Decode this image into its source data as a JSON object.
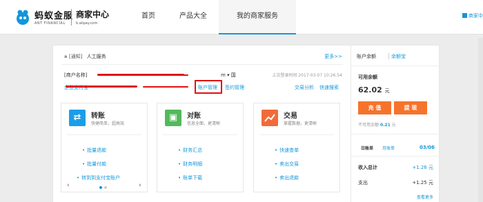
{
  "header": {
    "brand": "蚂蚁金服",
    "brand_en": "ANT FINANCIAL",
    "center": "商家中心",
    "center_url": "b.alipay.com",
    "nav": [
      "首页",
      "产品大全",
      "我的商家服务"
    ],
    "merchant_link": "商家中"
  },
  "notice": {
    "tag": "[通知]",
    "text": "人工服务",
    "more": "更多>>"
  },
  "account": {
    "name_prefix": "[商户名称]",
    "id_suffix": "m",
    "id_hint": "▾ 国",
    "last_login": "上次登录时间 2017-03-07 10:26:54",
    "links_left": "企业支付宝",
    "acct_manage": "账户管理",
    "sign_manage": "签约管理",
    "trade_analysis": "交易分析",
    "quick_search": "快速搜索"
  },
  "cards": [
    {
      "title": "转账",
      "subtitle": "快捷简单，超高效",
      "icon": "transfer-icon",
      "icon_color": "#1a9ee8",
      "items": [
        "批量退款",
        "批量付款",
        "转到到支付宝账户"
      ]
    },
    {
      "title": "对账",
      "subtitle": "信息全面，更清晰",
      "icon": "reconcile-icon",
      "icon_color": "#52b95a",
      "items": [
        "财务汇总",
        "财务明细",
        "账单下载"
      ]
    },
    {
      "title": "交易",
      "subtitle": "掌握数据，更清晰",
      "icon": "trade-chart-icon",
      "icon_color": "#f26a3a",
      "items": [
        "快速查单",
        "卖出交易",
        "卖出退款"
      ]
    }
  ],
  "balance": {
    "tab_balance": "账户余额",
    "tab_yuebao": "余额宝",
    "label": "可用余额",
    "amount": "62.02",
    "unit": "元",
    "recharge": "充 值",
    "withdraw": "提 现",
    "unavailable_label": "不可用余额",
    "unavailable_value": "0.21",
    "unavailable_unit": "元",
    "tab_day": "日账单",
    "tab_month": "月账单",
    "date": "03/06",
    "income_label": "收入总计",
    "income_value": "+1.26 元",
    "expense_label": "支出",
    "expense_value": "+1.25 元",
    "detail": "查看更多"
  },
  "colors": {
    "accent": "#1296db",
    "orange": "#f6732b",
    "highlight_red": "#e01010"
  }
}
